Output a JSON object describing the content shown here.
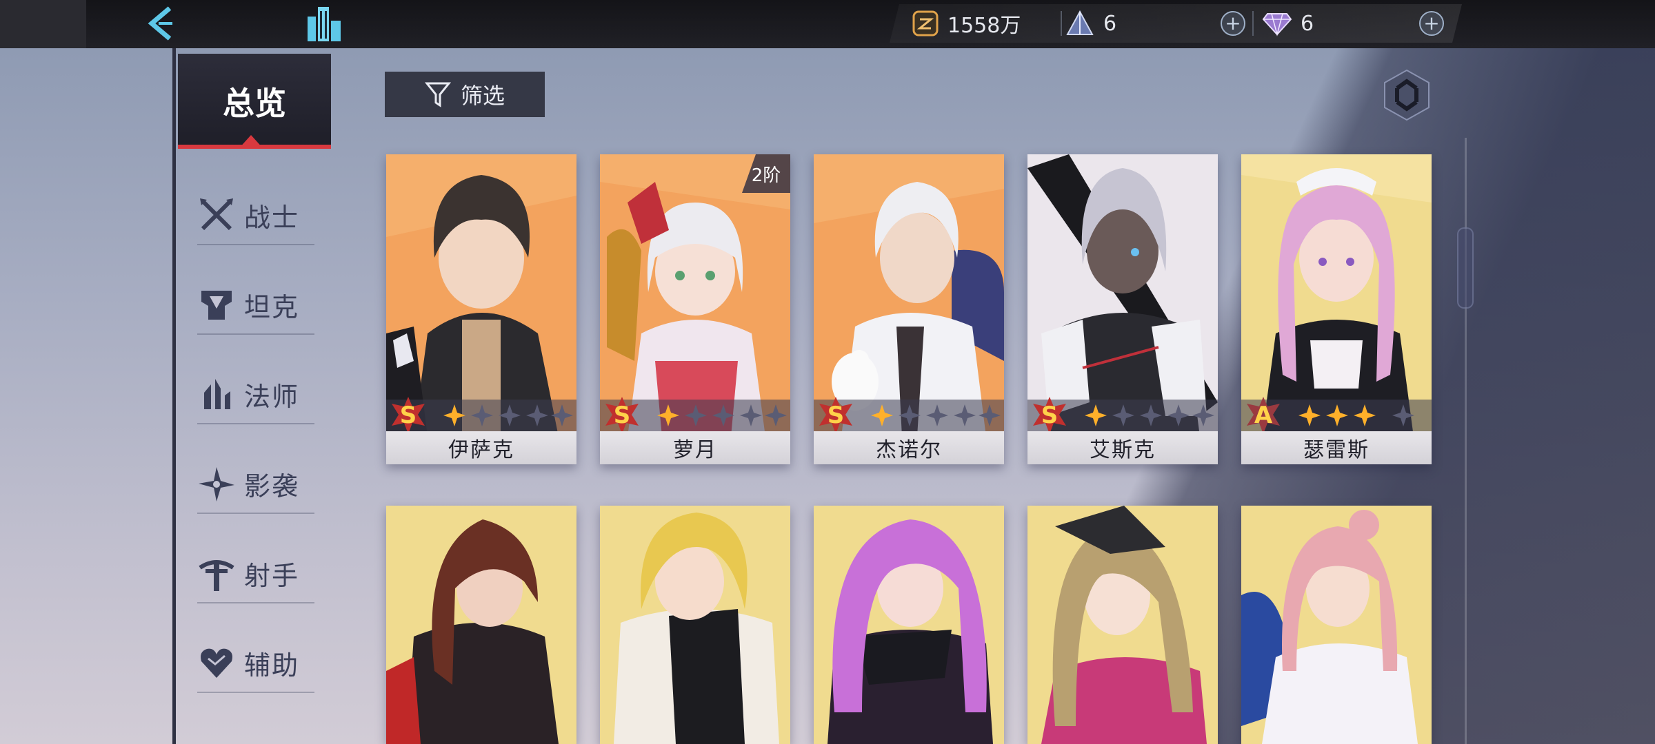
{
  "topbar": {
    "gold": "1558万",
    "crystal": "6",
    "diamond": "6"
  },
  "sidebar": {
    "overview": "总览",
    "categories": [
      {
        "label": "战士",
        "icon": "swords-icon"
      },
      {
        "label": "坦克",
        "icon": "shield-icon"
      },
      {
        "label": "法师",
        "icon": "mage-icon"
      },
      {
        "label": "影袭",
        "icon": "shuriken-icon"
      },
      {
        "label": "射手",
        "icon": "crossbow-icon"
      },
      {
        "label": "辅助",
        "icon": "heart-icon"
      }
    ]
  },
  "filter": {
    "label": "筛选"
  },
  "cards": [
    {
      "name": "伊萨克",
      "grade": "S",
      "stars_lit": 1,
      "stars_total": 5,
      "rank": ""
    },
    {
      "name": "萝月",
      "grade": "S",
      "stars_lit": 1,
      "stars_total": 5,
      "rank": "2阶"
    },
    {
      "name": "杰诺尔",
      "grade": "S",
      "stars_lit": 1,
      "stars_total": 5,
      "rank": ""
    },
    {
      "name": "艾斯克",
      "grade": "S",
      "stars_lit": 1,
      "stars_total": 5,
      "rank": ""
    },
    {
      "name": "瑟雷斯",
      "grade": "A",
      "stars_lit": 3,
      "stars_total": 4,
      "rank": ""
    }
  ],
  "colors": {
    "accent_red": "#d8393f",
    "grade_gold": "#ffd24a",
    "card_orange": "#f3a35e",
    "card_yellow": "#f0db8f"
  }
}
